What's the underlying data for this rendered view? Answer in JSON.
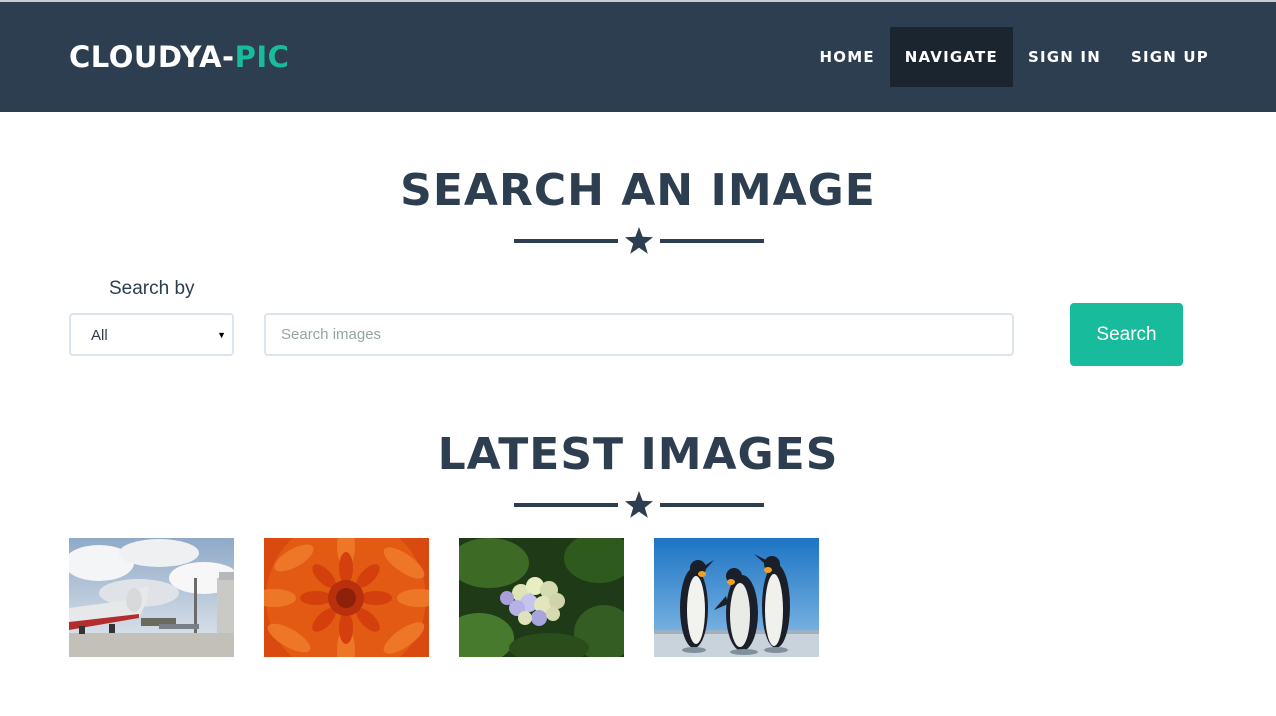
{
  "brand": {
    "main": "CLOUDYA-",
    "accent": "PIC"
  },
  "nav": {
    "items": [
      {
        "label": "HOME",
        "active": false
      },
      {
        "label": "NAVIGATE",
        "active": true
      },
      {
        "label": "SIGN IN",
        "active": false
      },
      {
        "label": "SIGN UP",
        "active": false
      }
    ]
  },
  "search_section": {
    "title": "SEARCH AN IMAGE",
    "search_by_label": "Search by",
    "select_value": "All",
    "input_placeholder": "Search images",
    "input_value": "",
    "button_label": "Search"
  },
  "latest_section": {
    "title": "LATEST IMAGES",
    "images": [
      {
        "subject": "airplane"
      },
      {
        "subject": "flower"
      },
      {
        "subject": "hydrangea"
      },
      {
        "subject": "penguins"
      }
    ]
  },
  "colors": {
    "navbar": "#2c3e50",
    "accent": "#18bc9c",
    "nav_active": "#1a2530",
    "text_dark": "#2c3e50"
  },
  "icons": {
    "divider": "star-icon",
    "select_caret": "caret-down-icon"
  }
}
